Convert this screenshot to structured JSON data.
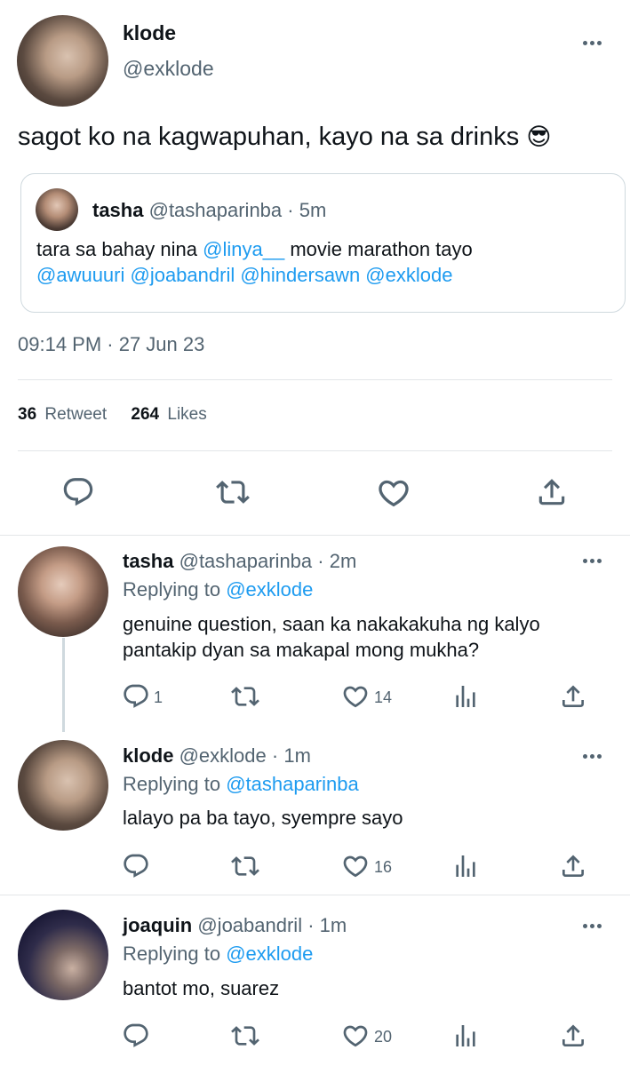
{
  "main_tweet": {
    "name": "klode",
    "handle": "@exklode",
    "text": "sagot ko na kagwapuhan, kayo na sa drinks",
    "emoji": "😎",
    "timestamp": "09:14 PM · 27 Jun 23",
    "retweet_count": "36",
    "retweet_label": "Retweet",
    "like_count": "264",
    "like_label": "Likes",
    "quote": {
      "name": "tasha",
      "handle": "@tashaparinba",
      "time": "· 5m",
      "text_before": "tara sa bahay nina ",
      "mention1": "@linya__",
      "text_after": " movie marathon tayo",
      "mentions_line": "@awuuuri @joabandril @hindersawn @exklode"
    }
  },
  "replies": [
    {
      "name": "tasha",
      "handle": "@tashaparinba",
      "time": "· 2m",
      "replying_label": "Replying to ",
      "replying_to": "@exklode",
      "text_line1": "genuine question, saan ka nakakakuha ng kalyo",
      "text_line2": "pantakip dyan sa makapal mong mukha?",
      "reply_count": "1",
      "like_count": "14"
    },
    {
      "name": "klode",
      "handle": "@exklode",
      "time": "· 1m",
      "replying_label": "Replying to ",
      "replying_to": "@tashaparinba",
      "text_line1": "lalayo pa ba tayo, syempre sayo",
      "reply_count": "",
      "like_count": "16"
    },
    {
      "name": "joaquin",
      "handle": "@joabandril",
      "time": "· 1m",
      "replying_label": "Replying to ",
      "replying_to": "@exklode",
      "text_line1": "bantot mo, suarez",
      "reply_count": "",
      "like_count": "20"
    }
  ],
  "colors": {
    "accent": "#1d9bf0",
    "muted": "#536471",
    "divider": "#e3e6e8"
  },
  "icons": [
    "more-icon",
    "reply-icon",
    "retweet-icon",
    "like-icon",
    "share-icon",
    "analytics-icon"
  ]
}
